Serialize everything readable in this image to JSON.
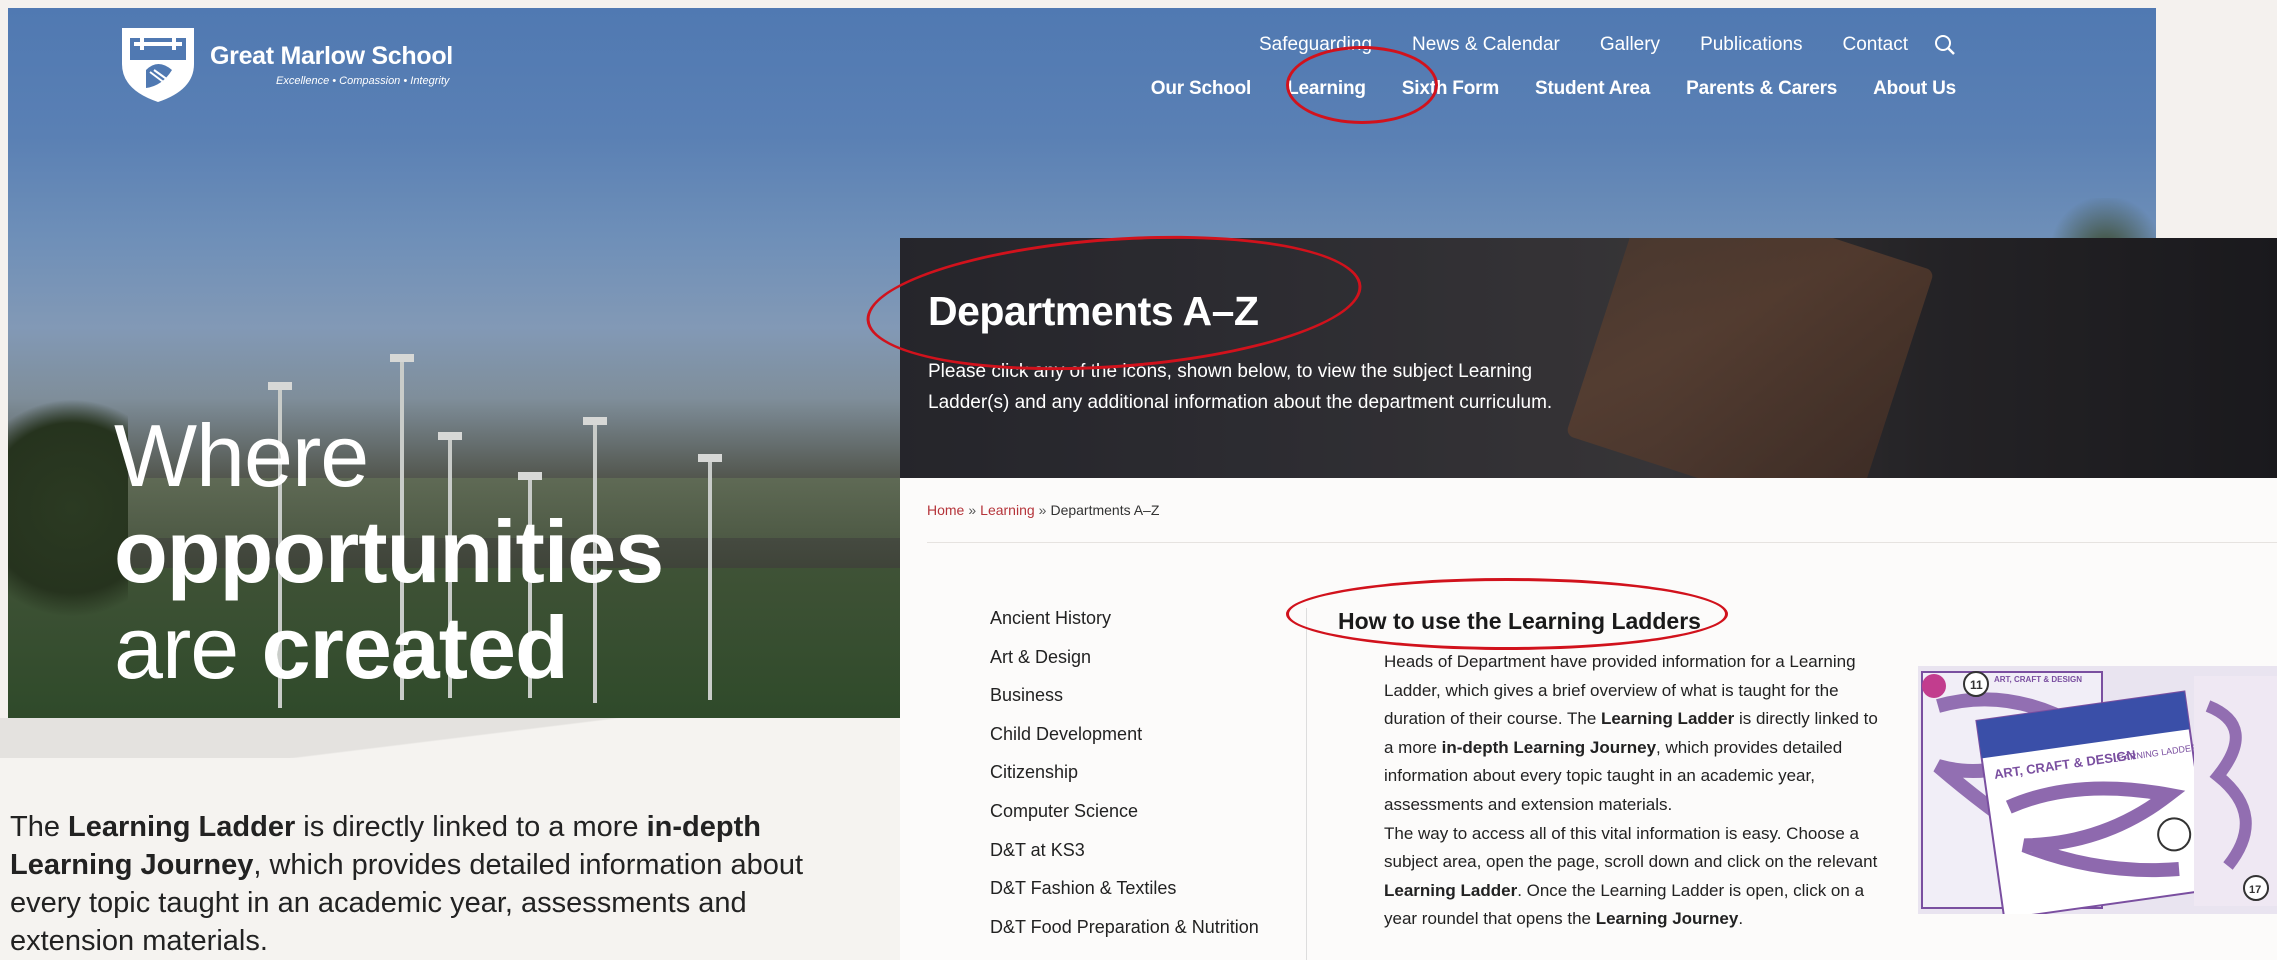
{
  "site": {
    "school_name": "Great Marlow School",
    "tagline": "Excellence • Compassion • Integrity",
    "util_nav": [
      "Safeguarding",
      "News & Calendar",
      "Gallery",
      "Publications",
      "Contact"
    ],
    "main_nav": [
      "Our School",
      "Learning",
      "Sixth Form",
      "Student Area",
      "Parents & Carers",
      "About Us"
    ],
    "hero": {
      "line1": "Where",
      "line2": "opportunities",
      "line3_a": "are ",
      "line3_b": "created"
    }
  },
  "intro": {
    "t1": "The ",
    "b1": "Learning Ladder",
    "t2": " is directly linked to a more ",
    "b2": "in-depth Learning Journey",
    "t3": ", which provides detailed information about every topic taught in an academic year, assessments and extension materials."
  },
  "departments": {
    "title": "Departments A–Z",
    "subtitle": "Please click any of the icons, shown below, to view the subject Learning Ladder(s) and any additional information about the department curriculum.",
    "breadcrumb": {
      "home": "Home",
      "sep": "»",
      "learning": "Learning",
      "current": "Departments A–Z"
    },
    "subjects": [
      "Ancient History",
      "Art & Design",
      "Business",
      "Child Development",
      "Citizenship",
      "Computer Science",
      "D&T at KS3",
      "D&T Fashion & Textiles",
      "D&T Food Preparation & Nutrition"
    ],
    "how": {
      "title": "How to use the Learning Ladders",
      "p1a": "Heads of Department have provided information for a Learning Ladder, which gives a brief overview of what is taught for the duration of their course. The ",
      "p1b": "Learning Ladder",
      "p1c": " is directly linked to a more ",
      "p1d": "in-depth Learning Journey",
      "p1e": ", which provides detailed information about every topic taught in an academic year, assessments and extension materials.",
      "p2a": "The way to access all of this vital information is easy. Choose a subject area, open the page, scroll down and click on the relevant ",
      "p2b": "Learning Ladder",
      "p2c": ". Once the Learning Ladder is open, click on a year roundel that opens the ",
      "p2d": "Learning Journey",
      "p2e": "."
    },
    "thumb": {
      "heading": "ART, CRAFT & DESIGN",
      "sub": "LEARNING LADDER",
      "year_a": "11",
      "year_b": "17"
    }
  },
  "colors": {
    "link_red": "#b5343a",
    "annotation_red": "#d1121c",
    "nav_blue": "#5079b2"
  }
}
